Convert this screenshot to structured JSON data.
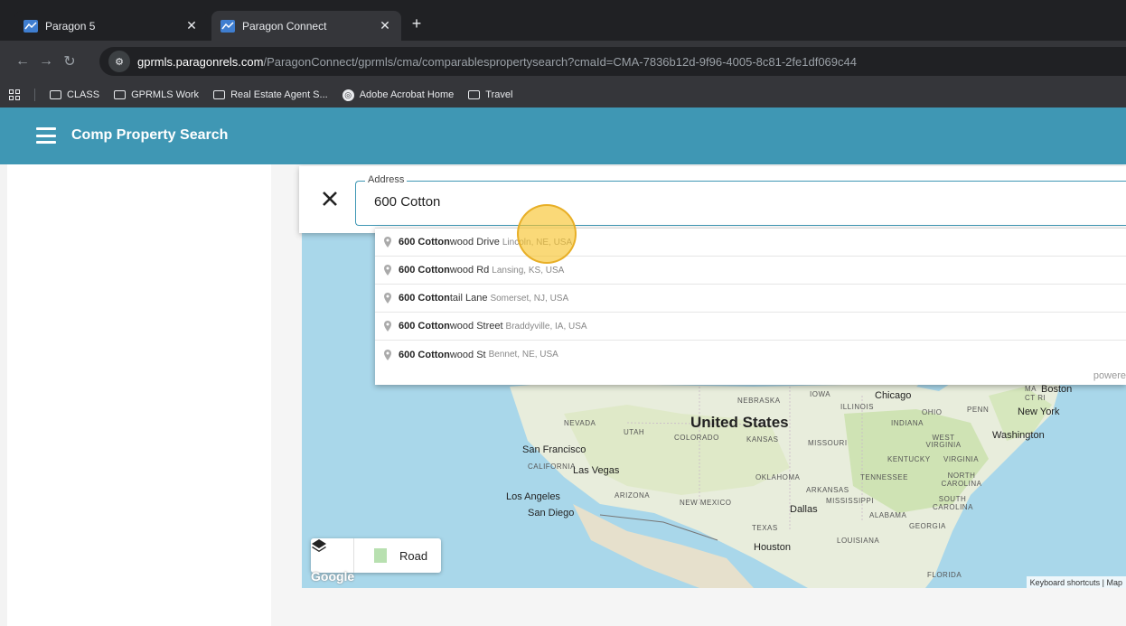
{
  "browser": {
    "tabs": [
      {
        "title": "Paragon 5",
        "active": false
      },
      {
        "title": "Paragon Connect",
        "active": true
      }
    ],
    "url_host": "gprmls.paragonrels.com",
    "url_path": "/ParagonConnect/gprmls/cma/comparablespropertysearch?cmaId=CMA-7836b12d-9f96-4005-8c81-2fe1df069c44",
    "bookmarks": [
      "CLASS",
      "GPRMLS Work",
      "Real Estate Agent S...",
      "Adobe Acrobat Home",
      "Travel"
    ]
  },
  "app": {
    "title": "Comp Property Search",
    "header_color": "#3f97b4"
  },
  "search": {
    "label": "Address",
    "value": "600 Cotton"
  },
  "autocomplete": {
    "items": [
      {
        "match": "600 Cotton",
        "rest": "wood Drive",
        "secondary": "Lincoln, NE, USA"
      },
      {
        "match": "600 Cotton",
        "rest": "wood Rd",
        "secondary": "Lansing, KS, USA"
      },
      {
        "match": "600 Cotton",
        "rest": "tail Lane",
        "secondary": "Somerset, NJ, USA"
      },
      {
        "match": "600 Cotton",
        "rest": "wood Street",
        "secondary": "Braddyville, IA, USA"
      },
      {
        "match": "600 Cotton",
        "rest": "wood St",
        "secondary": "Bennet, NE, USA"
      }
    ],
    "powered_by": "powere"
  },
  "map": {
    "country": "United States",
    "states": [
      "NEBRASKA",
      "IOWA",
      "ILLINOIS",
      "OHIO",
      "PENN",
      "NEVADA",
      "UTAH",
      "COLORADO",
      "KANSAS",
      "MISSOURI",
      "INDIANA",
      "WEST VIRGINIA",
      "VIRGINIA",
      "KENTUCKY",
      "CALIFORNIA",
      "OKLAHOMA",
      "TENNESSEE",
      "NORTH CAROLINA",
      "ARIZONA",
      "NEW MEXICO",
      "ARKANSAS",
      "MISSISSIPPI",
      "SOUTH CAROLINA",
      "ALABAMA",
      "GEORGIA",
      "TEXAS",
      "LOUISIANA",
      "FLORIDA",
      "MA",
      "CT RI"
    ],
    "cities": [
      "Chicago",
      "Boston",
      "New York",
      "Washington",
      "San Francisco",
      "Las Vegas",
      "Los Angeles",
      "San Diego",
      "Dallas",
      "Houston"
    ],
    "map_type": "Road",
    "logo": "Google",
    "attribution": "Keyboard shortcuts | Map"
  }
}
